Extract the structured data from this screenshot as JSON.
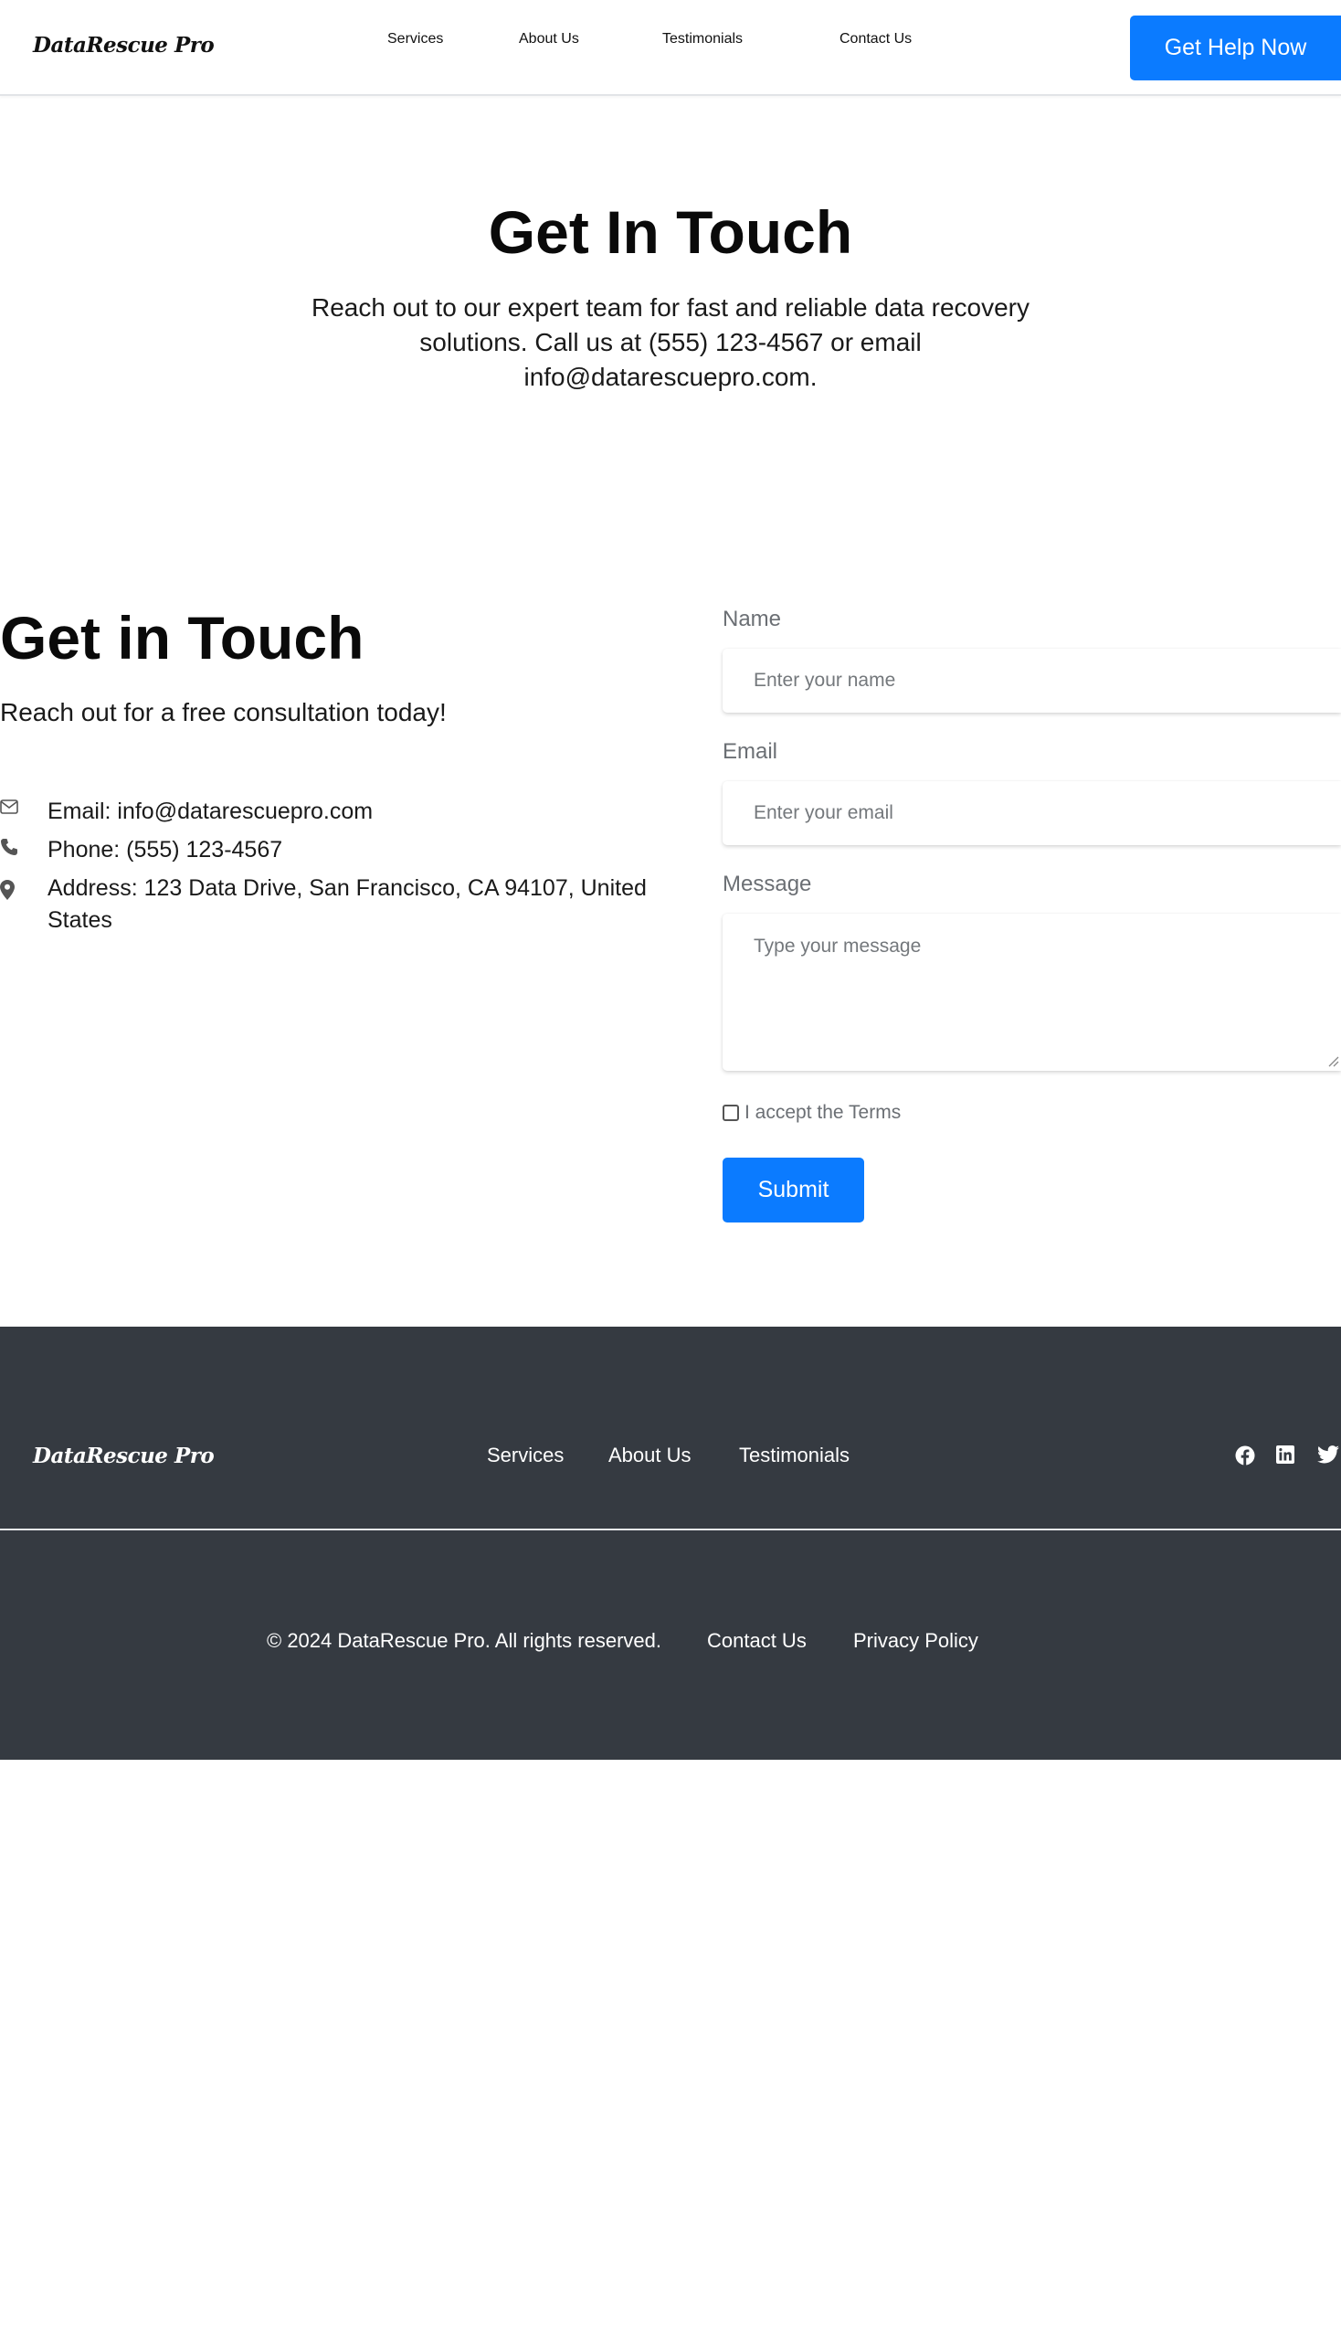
{
  "header": {
    "logo": "DataRescue Pro",
    "nav": [
      "Services",
      "About Us",
      "Testimonials",
      "Contact Us"
    ],
    "cta_label": "Get Help Now"
  },
  "hero": {
    "title": "Get In Touch",
    "text": "Reach out to our expert team for fast and reliable data recovery solutions. Call us at (555) 123-4567 or email info@datarescuepro.com."
  },
  "contact": {
    "title": "Get in Touch",
    "subtitle": "Reach out for a free consultation today!",
    "email": "Email: info@datarescuepro.com",
    "phone": "Phone: (555) 123-4567",
    "address": "Address: 123 Data Drive, San Francisco, CA 94107, United States",
    "icons": [
      "envelope-icon",
      "phone-icon",
      "map-pin-icon"
    ]
  },
  "form": {
    "name_label": "Name",
    "name_placeholder": "Enter your name",
    "email_label": "Email",
    "email_placeholder": "Enter your email",
    "message_label": "Message",
    "message_placeholder": "Type your message",
    "terms_label": "I accept the Terms",
    "terms_checked": false,
    "submit_label": "Submit"
  },
  "footer": {
    "logo": "DataRescue Pro",
    "nav": [
      "Services",
      "About Us",
      "Testimonials"
    ],
    "socials": [
      "facebook-icon",
      "linkedin-icon",
      "twitter-icon"
    ],
    "copyright": "© 2024 DataRescue Pro. All rights reserved.",
    "contact_link": "Contact Us",
    "privacy_link": "Privacy Policy"
  },
  "colors": {
    "accent": "#0b7bff",
    "footer_bg": "#353a41",
    "label_gray": "#6b6f74"
  }
}
